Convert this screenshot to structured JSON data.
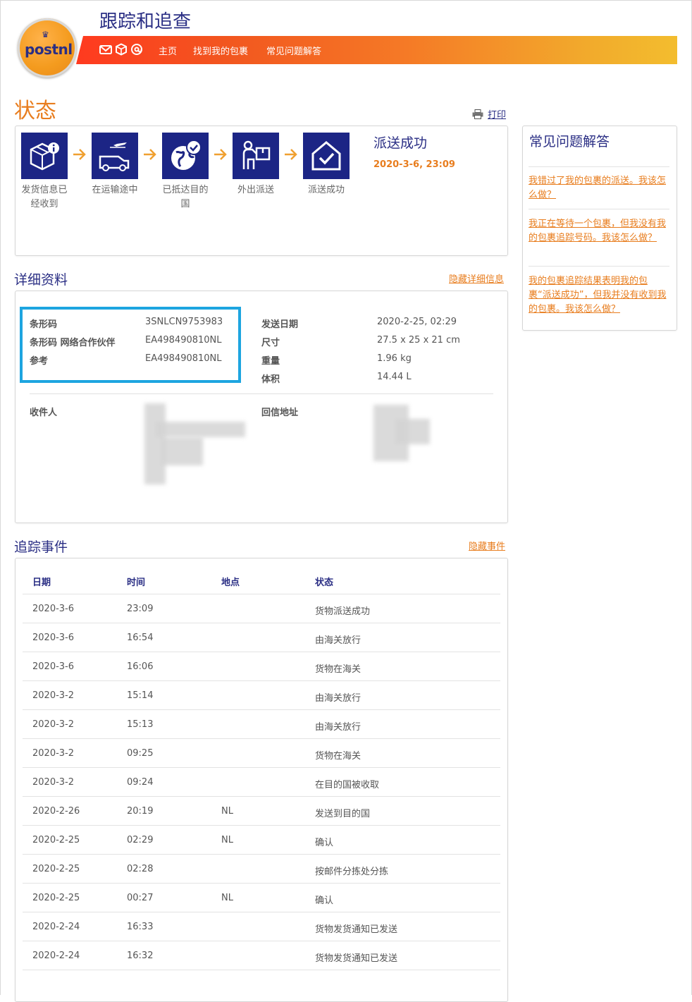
{
  "header": {
    "logo_text": "postnl",
    "title": "跟踪和追查",
    "nav": [
      "主页",
      "找到我的包裹",
      "常见问题解答"
    ]
  },
  "status": {
    "heading": "状态",
    "print_label": "打印",
    "steps": [
      {
        "label": "发货信息已经收到",
        "icon": "box-info-icon"
      },
      {
        "label": "在运输途中",
        "icon": "plane-van-icon"
      },
      {
        "label": "已抵达目的国",
        "icon": "globe-check-icon"
      },
      {
        "label": "外出派送",
        "icon": "courier-parcel-icon"
      },
      {
        "label": "派送成功",
        "icon": "house-check-icon"
      }
    ],
    "current": "派送成功",
    "current_time": "2020-3-6, 23:09"
  },
  "faq": {
    "title": "常见问题解答",
    "items": [
      "我错过了我的包裹的派送。我该怎么做？",
      "我正在等待一个包裹，但我没有我的包裹追踪号码。我该怎么做？",
      "我的包裹追踪结果表明我的包裹“派送成功”，但我并没有收到我的包裹。我该怎么做？"
    ]
  },
  "details": {
    "heading": "详细资料",
    "toggle": "隐藏详细信息",
    "left": [
      {
        "label": "条形码",
        "value": "3SNLCN9753983"
      },
      {
        "label": "条形码 网络合作伙伴",
        "value": "EA498490810NL"
      },
      {
        "label": "参考",
        "value": "EA498490810NL"
      }
    ],
    "right": [
      {
        "label": "发送日期",
        "value": "2020-2-25, 02:29"
      },
      {
        "label": "尺寸",
        "value": "27.5 x 25 x 21 cm"
      },
      {
        "label": "重量",
        "value": "1.96 kg"
      },
      {
        "label": "体积",
        "value": "14.44 L"
      }
    ],
    "recipient_label": "收件人",
    "return_label": "回信地址"
  },
  "events": {
    "heading": "追踪事件",
    "toggle": "隐藏事件",
    "columns": [
      "日期",
      "时间",
      "地点",
      "状态"
    ],
    "rows": [
      [
        "2020-3-6",
        "23:09",
        "",
        "货物派送成功"
      ],
      [
        "2020-3-6",
        "16:54",
        "",
        "由海关放行"
      ],
      [
        "2020-3-6",
        "16:06",
        "",
        "货物在海关"
      ],
      [
        "2020-3-2",
        "15:14",
        "",
        "由海关放行"
      ],
      [
        "2020-3-2",
        "15:13",
        "",
        "由海关放行"
      ],
      [
        "2020-3-2",
        "09:25",
        "",
        "货物在海关"
      ],
      [
        "2020-3-2",
        "09:24",
        "",
        "在目的国被收取"
      ],
      [
        "2020-2-26",
        "20:19",
        "NL",
        "发送到目的国"
      ],
      [
        "2020-2-25",
        "02:29",
        "NL",
        "确认"
      ],
      [
        "2020-2-25",
        "02:28",
        "",
        "按邮件分拣处分拣"
      ],
      [
        "2020-2-25",
        "00:27",
        "NL",
        "确认"
      ],
      [
        "2020-2-24",
        "16:33",
        "",
        "货物发货通知已发送"
      ],
      [
        "2020-2-24",
        "16:32",
        "",
        "货物发货通知已发送"
      ]
    ]
  },
  "colors": {
    "brand_blue": "#2a2e84",
    "brand_orange": "#e87d1e",
    "step_bg": "#1c2585",
    "highlight": "#1da5e0"
  }
}
